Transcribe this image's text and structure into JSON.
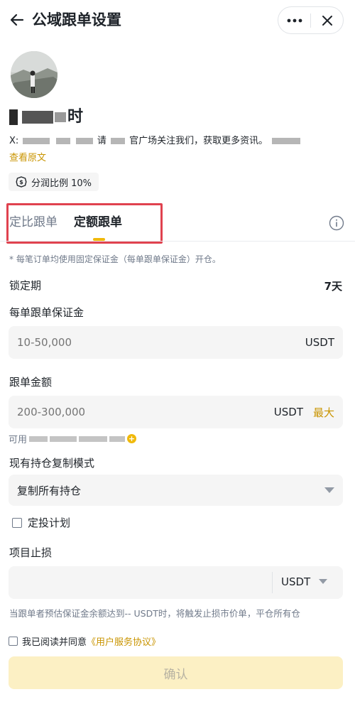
{
  "header": {
    "title": "公域跟单设置"
  },
  "profile": {
    "name_visible_char": "时",
    "bio_prefix": "X:",
    "bio_mid": "请",
    "bio_mid2": "官广场关注我们，获取更多资讯。",
    "view_original": "查看原文",
    "share_ratio": "分润比例 10%"
  },
  "tabs": {
    "ratio": "定比跟单",
    "fixed": "定额跟单",
    "active": "fixed"
  },
  "form": {
    "note": "* 每笔订单均使用固定保证金（每单跟单保证金）开仓。",
    "lock_label": "锁定期",
    "lock_value": "7天",
    "margin_label": "每单跟单保证金",
    "margin_placeholder": "10-50,000",
    "margin_unit": "USDT",
    "amount_label": "跟单金额",
    "amount_placeholder": "200-300,000",
    "amount_unit": "USDT",
    "amount_max": "最大",
    "available_label": "可用",
    "copy_mode_label": "现有持仓复制模式",
    "copy_mode_value": "复制所有持仓",
    "dca_label": "定投计划",
    "stop_loss_label": "项目止损",
    "stop_loss_unit": "USDT",
    "stop_loss_note": "当跟单者预估保证金余额达到-- USDT时，将触发止损市价单，平仓所有仓",
    "agree_text": "我已阅读并同意",
    "agree_link": "《用户服务协议》",
    "confirm": "确认"
  },
  "colors": {
    "accent": "#f0b90b",
    "link": "#c99400",
    "highlight_box": "#e0424f",
    "confirm_bg": "#fcf0c4"
  }
}
